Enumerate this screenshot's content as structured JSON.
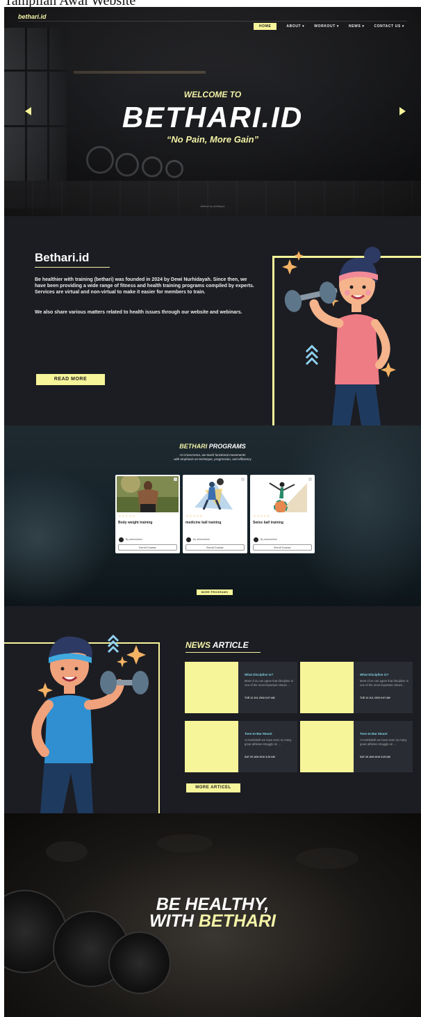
{
  "caption": "Tampilan Awal Website",
  "header": {
    "logo": "bethari.id",
    "nav": [
      {
        "label": "HOME",
        "active": true
      },
      {
        "label": "ABOUT ▾",
        "active": false
      },
      {
        "label": "WORKOUT ▾",
        "active": false
      },
      {
        "label": "NEWS ▾",
        "active": false
      },
      {
        "label": "CONTACT US ▾",
        "active": false
      }
    ]
  },
  "hero": {
    "welcome": "WELCOME TO",
    "title": "BETHARI.ID",
    "tagline": "“No Pain, More Gain”",
    "credit": "bethari by activity.id"
  },
  "about": {
    "title": "Bethari.id",
    "paragraph1": "Be healthier with training (bethari) was founded in 2024 by Dewi Nurhidayah. Since then, we have been providing a wide range of fitness and health training programs compiled by experts. Services are virtual and non-virtual to make it easier for members to train.",
    "paragraph2": "We also share various matters related to health issues through our website and webinars.",
    "read_more": "READ MORE"
  },
  "programs": {
    "title_accent": "BETHARI",
    "title_rest": " PROGRAMS",
    "subtitle_line1": "At CrossArena, we teach functional movements",
    "subtitle_line2": "with emphasis on technique, progression, and efficiency",
    "cards": [
      {
        "name": "Body weight training",
        "stars": "☆☆☆☆☆",
        "author": "By adminonline",
        "button": "Enroll Course"
      },
      {
        "name": "medicine ball training",
        "stars": "☆☆☆☆☆",
        "author": "By adminonline",
        "button": "Enroll Course"
      },
      {
        "name": "Swiss ball training",
        "stars": "☆☆☆☆☆",
        "author": "By adminonline",
        "button": "Enroll Course"
      }
    ],
    "more": "MORE PROGRAMS"
  },
  "news": {
    "title_accent": "NEWS",
    "title_rest": " ARTICLE",
    "articles": [
      {
        "title": "What Discipline is?",
        "desc": "Most of us can agree that discipline is one of the most important virtues ...",
        "date": "TUE 12 JUL 2016 6:07 AM"
      },
      {
        "title": "What Discipline is?",
        "desc": "Most of us can agree that discipline is one of the most important virtues ...",
        "date": "TUE 12 JUL 2016 6:07 AM"
      },
      {
        "title": "Toes-to-Bar Mount",
        "desc": "At KettlebellI we have seen so many great athletes struggle on ...",
        "date": "SAT 25 JUN 2016 3:29 AM"
      },
      {
        "title": "Toes-to-Bar Mount",
        "desc": "At KettlebellI we have seen so many great athletes struggle on ...",
        "date": "SAT 25 JUN 2016 3:29 AM"
      }
    ],
    "more": "MORE ARTICEL"
  },
  "footer": {
    "line1": "BE HEALTHY,",
    "line2_prefix": "WITH ",
    "line2_accent": "BETHARI"
  },
  "colors": {
    "accent": "#f7f59a",
    "dark": "#1c1d22",
    "link": "#7fd3e6"
  }
}
